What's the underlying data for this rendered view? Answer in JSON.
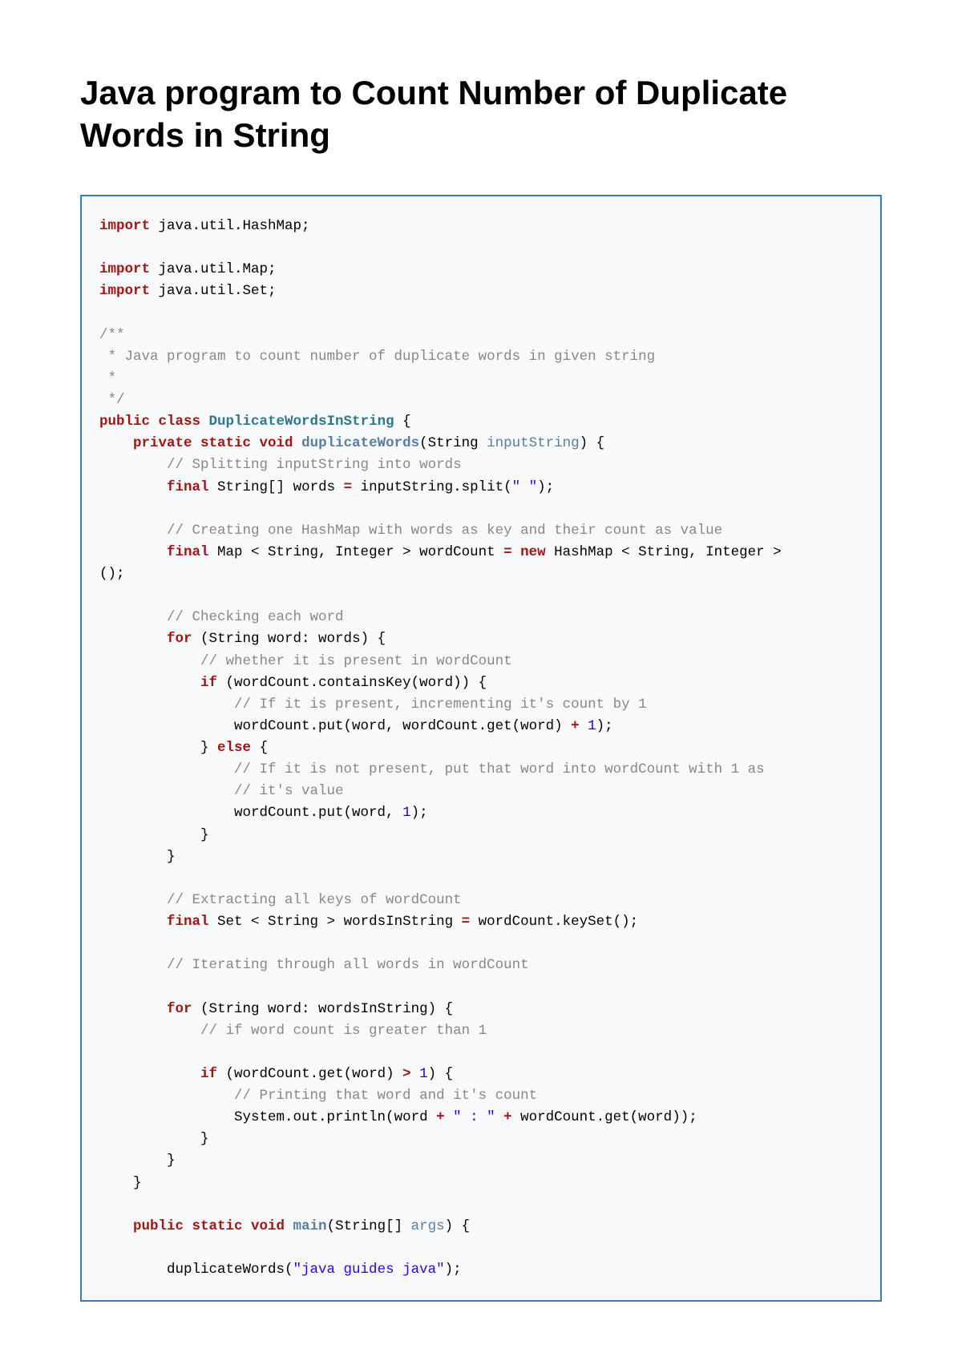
{
  "title": "Java program to Count Number of Duplicate Words in String",
  "code": {
    "l01_kw": "import",
    "l01_rest": " java.util.HashMap;",
    "l02_kw": "import",
    "l02_rest": " java.util.Map;",
    "l03_kw": "import",
    "l03_rest": " java.util.Set;",
    "l04": "/**",
    "l05": " * Java program to count number of duplicate words in given string",
    "l06": " *",
    "l07": " */",
    "l08_kw": "public class",
    "l08_cl": " DuplicateWordsInString",
    "l08_rest": " {",
    "l09_indent": "    ",
    "l09_kw": "private static void",
    "l09_mth": " duplicateWords",
    "l09_paren_open": "(",
    "l09_type": "String ",
    "l09_param": "inputString",
    "l09_paren_close": ") {",
    "l10_cm": "        // Splitting inputString into words",
    "l11_indent": "        ",
    "l11_kw": "final",
    "l11_type": " String[] ",
    "l11_var": "words",
    "l11_eq": " = ",
    "l11_rest": "inputString.split(",
    "l11_str": "\" \"",
    "l11_end": ");",
    "l12_cm": "        // Creating one HashMap with words as key and their count as value",
    "l13_indent": "        ",
    "l13_kw": "final",
    "l13_a": " Map < String, Integer > ",
    "l13_var": "wordCount",
    "l13_eq": " = ",
    "l13_new": "new",
    "l13_b": " HashMap < String, Integer > ",
    "l13_nl": "();",
    "l14_cm": "        // Checking each word",
    "l15_indent": "        ",
    "l15_kw": "for",
    "l15_rest": " (String word: words) {",
    "l16_cm": "            // whether it is present in wordCount",
    "l17_indent": "            ",
    "l17_kw": "if",
    "l17_rest": " (wordCount.containsKey(word)) {",
    "l18_cm": "                // If it is present, incrementing it's count by 1",
    "l19_indent": "                ",
    "l19_a": "wordCount.put(word, wordCount.get(word) ",
    "l19_op": "+",
    "l19_sp": " ",
    "l19_num": "1",
    "l19_end": ");",
    "l20_indent": "            ",
    "l20_a": "} ",
    "l20_kw": "else",
    "l20_b": " {",
    "l21_cm": "                // If it is not present, put that word into wordCount with 1 as",
    "l22_cm": "                // it's value",
    "l23_indent": "                ",
    "l23_a": "wordCount.put(word, ",
    "l23_num": "1",
    "l23_end": ");",
    "l24": "            }",
    "l25": "        }",
    "l26_cm": "        // Extracting all keys of wordCount",
    "l27_indent": "        ",
    "l27_kw": "final",
    "l27_a": " Set < String > ",
    "l27_var": "wordsInString",
    "l27_eq": " = ",
    "l27_b": "wordCount.keySet();",
    "l28_cm": "        // Iterating through all words in wordCount",
    "l29_indent": "        ",
    "l29_kw": "for",
    "l29_rest": " (String word: wordsInString) {",
    "l30_cm": "            // if word count is greater than 1",
    "l31_indent": "            ",
    "l31_kw": "if",
    "l31_a": " (wordCount.get(word) ",
    "l31_op": ">",
    "l31_sp": " ",
    "l31_num": "1",
    "l31_end": ") {",
    "l32_cm": "                // Printing that word and it's count",
    "l33_indent": "                ",
    "l33_a": "System.out.println(word ",
    "l33_op1": "+",
    "l33_sp1": " ",
    "l33_str": "\" : \"",
    "l33_sp2": " ",
    "l33_op2": "+",
    "l33_b": " wordCount.get(word));",
    "l34": "            }",
    "l35": "        }",
    "l36": "    }",
    "l37_indent": "    ",
    "l37_kw": "public static void",
    "l37_mth": " main",
    "l37_a": "(String[] ",
    "l37_param": "args",
    "l37_b": ") {",
    "l38_indent": "        ",
    "l38_a": "duplicateWords(",
    "l38_str": "\"java guides java\"",
    "l38_end": ");"
  }
}
